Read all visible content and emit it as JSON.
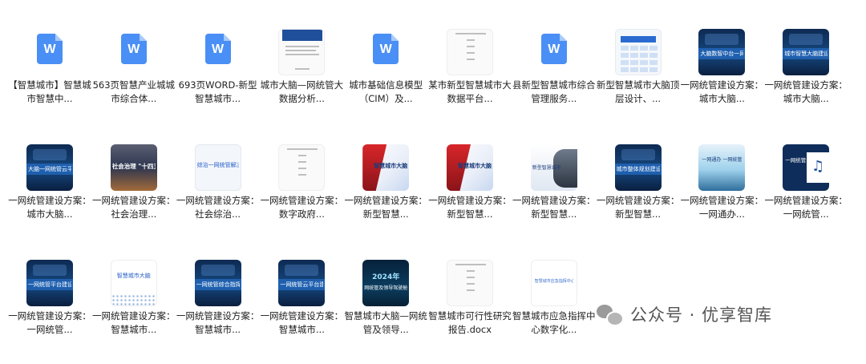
{
  "files": [
    {
      "caption": "【智慧城市】智慧城市智慧中...",
      "thumb": "word",
      "icon_letter": "W"
    },
    {
      "caption": "563页智慧产业城城市综合体...",
      "thumb": "word",
      "icon_letter": "W"
    },
    {
      "caption": "693页WORD-新型智慧城市...",
      "thumb": "word",
      "icon_letter": "W"
    },
    {
      "caption": "城市大脑—网统管大数据分析...",
      "thumb": "doc-blue"
    },
    {
      "caption": "城市基础信息模型（CIM）及...",
      "thumb": "word",
      "icon_letter": "W"
    },
    {
      "caption": "某市新型智慧城市大数据平台...",
      "thumb": "doc-plain"
    },
    {
      "caption": "县新型智慧城市综合管理服务...",
      "thumb": "word",
      "icon_letter": "W"
    },
    {
      "caption": "新型智慧城市大脑顶层设计、...",
      "thumb": "grid"
    },
    {
      "caption": "一网统管建设方案：城市大脑...",
      "thumb": "dark",
      "text": "大脑数智中台一网统管"
    },
    {
      "caption": "一网统管建设方案：城市大脑...",
      "thumb": "dark",
      "text": "城市智慧大脑建设方案"
    },
    {
      "caption": "一网统管建设方案：城市大脑...",
      "thumb": "dark",
      "text": "大脑一网统管云平台建设"
    },
    {
      "caption": "一网统管建设方案：社会治理...",
      "thumb": "city",
      "text": "社会治理 \"十四五\""
    },
    {
      "caption": "一网统管建设方案：社会综治...",
      "thumb": "light",
      "text": "综治一网统管解决"
    },
    {
      "caption": "一网统管建设方案：数字政府...",
      "thumb": "doc-plain"
    },
    {
      "caption": "一网统管建设方案：新型智慧...",
      "thumb": "red",
      "text": "智慧城市大脑运营中心"
    },
    {
      "caption": "一网统管建设方案：新型智慧...",
      "thumb": "red",
      "text": "智慧城市大脑建设方案"
    },
    {
      "caption": "一网统管建设方案：新型智慧...",
      "thumb": "hand",
      "text": "新型智慧城市"
    },
    {
      "caption": "一网统管建设方案：新型智慧...",
      "thumb": "dark",
      "text": "城市整体规划建设"
    },
    {
      "caption": "一网统管建设方案：一网通办...",
      "thumb": "cyan",
      "text": "一网通办 一网统管"
    },
    {
      "caption": "一网统管建设方案：一网统管...",
      "thumb": "music",
      "text": "一网统管"
    },
    {
      "caption": "一网统管建设方案：一网统管...",
      "thumb": "dark",
      "text": "一网统管平台建设"
    },
    {
      "caption": "一网统管建设方案：智慧城市...",
      "thumb": "white",
      "text": "智慧城市大脑"
    },
    {
      "caption": "一网统管建设方案：智慧城市...",
      "thumb": "dark",
      "text": "一网统管综合指挥"
    },
    {
      "caption": "一网统管建设方案：智慧城市...",
      "thumb": "dark",
      "text": "一网统管云平台建设"
    },
    {
      "caption": "智慧城市大脑—网统管及领导...",
      "thumb": "neon",
      "text": "网统管及领导驾驶舱",
      "year": "2024年"
    },
    {
      "caption": "智慧城市可行性研究报告.docx",
      "thumb": "doc-title"
    },
    {
      "caption": "智慧城市应急指挥中心数字化...",
      "thumb": "title-doc",
      "text": "智慧城市应急指挥中心"
    }
  ],
  "watermark": {
    "text": "公众号 · 优享智库",
    "icon": "wechat-icon"
  }
}
